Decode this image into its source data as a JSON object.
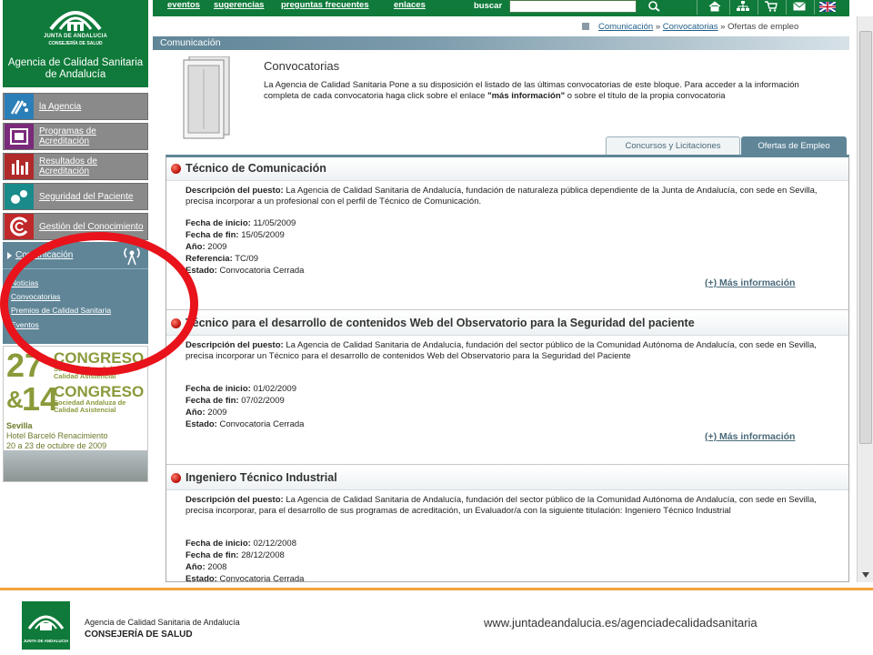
{
  "logo": {
    "org": "JUNTA DE ANDALUCIA",
    "dept": "CONSEJERÍA DE SALUD",
    "agency": "Agencia de Calidad Sanitaria de Andalucía"
  },
  "topnav": {
    "links": [
      "eventos",
      "sugerencias",
      "preguntas frecuentes",
      "enlaces"
    ],
    "search_label": "buscar",
    "search_value": ""
  },
  "breadcrumb": [
    "Comunicación",
    "»",
    "Convocatorias",
    "»",
    "Ofertas de empleo"
  ],
  "section_title": "Comunicación",
  "sidebar": {
    "items": [
      {
        "label": "la Agencia",
        "icon": "agency-icon"
      },
      {
        "label": "Programas de Acreditación",
        "icon": "accreditation-icon"
      },
      {
        "label": "Resultados de Acreditación",
        "icon": "results-icon"
      },
      {
        "label": "Seguridad del Paciente",
        "icon": "patient-safety-icon"
      },
      {
        "label": "Gestión del Conocimiento",
        "icon": "knowledge-icon"
      }
    ],
    "comm": {
      "label": "Comunicación",
      "sublinks": [
        "Noticias",
        "Convocatorias",
        "Premios de Calidad Sanitaria",
        "Eventos"
      ]
    },
    "banner": {
      "num1": "27",
      "congreso1": "CONGRESO",
      "soc1": "Sociedad Española de Calidad Asistencial",
      "amp": "&",
      "num2": "14",
      "congreso2": "CONGRESO",
      "soc2": "Sociedad Andaluza de Calidad Asistencial",
      "city": "Sevilla",
      "venue": "Hotel Barceló Renacimiento",
      "dates": "20 a 23 de octubre de 2009"
    }
  },
  "intro": {
    "title": "Convocatorias",
    "text_1": "La Agencia de Calidad Sanitaria Pone a su disposición el listado de las últimas convocatorias de este bloque. Para acceder a la información completa de cada convocatoria haga click sobre el enlace ",
    "text_bold": "\"más información\"",
    "text_2": " o sobre el título de la propia convocatoria"
  },
  "tabs": [
    "Concursos y Licitaciones",
    "Ofertas de Empleo"
  ],
  "field_labels": {
    "desc": "Descripción del puesto:",
    "start": "Fecha de inicio:",
    "end": "Fecha de fin:",
    "year": "Año:",
    "ref": "Referencia:",
    "status": "Estado:"
  },
  "more_info": "(+) Más información",
  "jobs": [
    {
      "title": "Técnico de Comunicación",
      "description": "La Agencia de Calidad Sanitaria de Andalucía, fundación de naturaleza pública dependiente de la Junta de Andalucía, con sede en Sevilla, precisa incorporar a un profesional con el perfil de Técnico de Comunicación.",
      "start": "11/05/2009",
      "end": "15/05/2009",
      "year": "2009",
      "ref": "TC/09",
      "status": "Convocatoria Cerrada"
    },
    {
      "title": "Técnico para el desarrollo de contenidos Web del Observatorio para la Seguridad del paciente",
      "description": "La Agencia de Calidad Sanitaria de Andalucía, fundación del sector público de la Comunidad Autónoma de Andalucía, con sede en Sevilla, precisa incorporar un Técnico para el desarrollo de contenidos Web del Observatorio para la Seguridad del Paciente",
      "start": "01/02/2009",
      "end": "07/02/2009",
      "year": "2009",
      "status": "Convocatoria Cerrada"
    },
    {
      "title": "Ingeniero Técnico Industrial",
      "description": "La Agencia de Calidad Sanitaria de Andalucía, fundación del sector público de la Comunidad Autónoma de Andalucía, con sede en Sevilla, precisa incorporar, para el desarrollo de sus programas de acreditación, un Evaluador/a con la siguiente titulación: Ingeniero Técnico Industrial",
      "start": "02/12/2008",
      "end": "28/12/2008",
      "year": "2008",
      "status": "Convocatoria Cerrada"
    }
  ],
  "footer": {
    "logo_text": "JUNTA DE ANDALUCIA",
    "agency": "Agencia de Calidad Sanitaria de Andalucía",
    "consejeria": "CONSEJERÍA DE SALUD",
    "url": "www.juntadeandalucia.es/agenciadecalidadsanitaria"
  },
  "colors": {
    "brand_green": "#0f7a3a",
    "nav_gray": "#8a8a8a",
    "comm_blue": "#5f8597",
    "annotation_red": "#e8131b",
    "footer_orange": "#f2a23a"
  }
}
